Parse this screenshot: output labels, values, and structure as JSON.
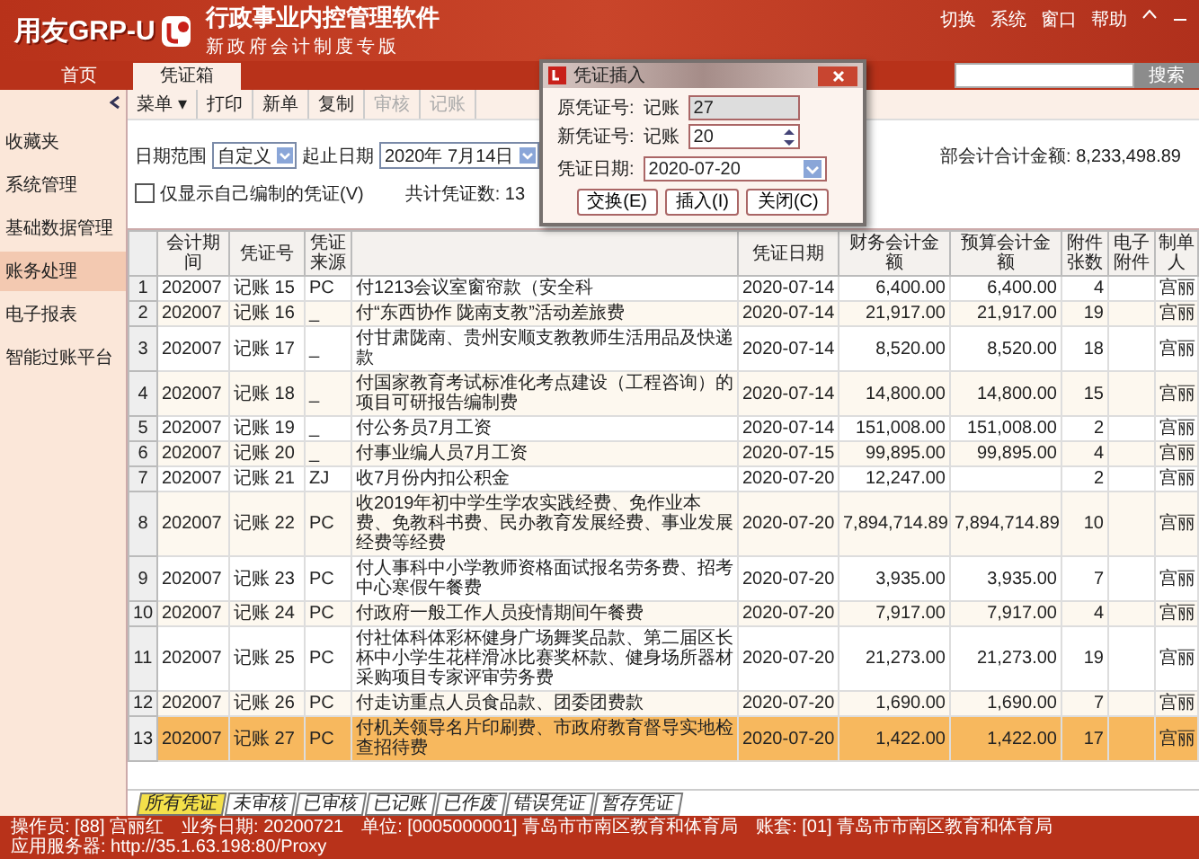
{
  "app": {
    "logo": "用友GRP-U",
    "product": "行政事业内控管理软件",
    "edition": "新政府会计制度专版",
    "menu": [
      "切换",
      "系统",
      "窗口",
      "帮助"
    ]
  },
  "tabs": [
    {
      "label": "首页",
      "selected": false
    },
    {
      "label": "凭证箱",
      "selected": true
    }
  ],
  "search": {
    "button": "搜索"
  },
  "sidebar": {
    "items": [
      {
        "label": "收藏夹",
        "selected": false
      },
      {
        "label": "系统管理",
        "selected": false
      },
      {
        "label": "基础数据管理",
        "selected": false
      },
      {
        "label": "账务处理",
        "selected": true
      },
      {
        "label": "电子报表",
        "selected": false
      },
      {
        "label": "智能过账平台",
        "selected": false
      }
    ]
  },
  "toolbar": [
    {
      "label": "菜单 ▾",
      "disabled": false
    },
    {
      "label": "打印",
      "disabled": false
    },
    {
      "label": "新单",
      "disabled": false
    },
    {
      "label": "复制",
      "disabled": false
    },
    {
      "label": "审核",
      "disabled": true
    },
    {
      "label": "记账",
      "disabled": true
    }
  ],
  "filters": {
    "range_label": "日期范围",
    "range_value": "自定义",
    "date_label": "起止日期",
    "date_value": "2020年 7月14日",
    "own_only": {
      "label": "仅显示自己编制的凭证(V)",
      "checked": false
    },
    "count": "共计凭证数: 13",
    "total": "部会计合计金额: 8,233,498.89"
  },
  "table": {
    "columns": [
      "会计期间",
      "凭证号",
      "凭证来源",
      "凭证日期",
      "财务会计金额",
      "预算会计金额",
      "附件张数",
      "电子附件",
      "制单人"
    ],
    "rows": [
      {
        "index": "1",
        "period": "202007",
        "number": "记账 15",
        "source": "PC",
        "summary": "付1213会议室窗帘款（安全科",
        "date": "2020-07-14",
        "financial": "6,400.00",
        "budget": "6,400.00",
        "attachments": "4",
        "maker": "宫丽",
        "selected": false
      },
      {
        "index": "2",
        "period": "202007",
        "number": "记账 16",
        "source": "_",
        "summary": "付“东西协作  陇南支教”活动差旅费",
        "date": "2020-07-14",
        "financial": "21,917.00",
        "budget": "21,917.00",
        "attachments": "19",
        "maker": "宫丽",
        "selected": false
      },
      {
        "index": "3",
        "period": "202007",
        "number": "记账 17",
        "source": "_",
        "summary": "付甘肃陇南、贵州安顺支教教师生活用品及快递款",
        "date": "2020-07-14",
        "financial": "8,520.00",
        "budget": "8,520.00",
        "attachments": "18",
        "maker": "宫丽",
        "selected": false
      },
      {
        "index": "4",
        "period": "202007",
        "number": "记账 18",
        "source": "_",
        "summary": "付国家教育考试标准化考点建设（工程咨询）的项目可研报告编制费",
        "date": "2020-07-14",
        "financial": "14,800.00",
        "budget": "14,800.00",
        "attachments": "15",
        "maker": "宫丽",
        "selected": false
      },
      {
        "index": "5",
        "period": "202007",
        "number": "记账 19",
        "source": "_",
        "summary": "付公务员7月工资",
        "date": "2020-07-14",
        "financial": "151,008.00",
        "budget": "151,008.00",
        "attachments": "2",
        "maker": "宫丽",
        "selected": false
      },
      {
        "index": "6",
        "period": "202007",
        "number": "记账 20",
        "source": "_",
        "summary": "付事业编人员7月工资",
        "date": "2020-07-15",
        "financial": "99,895.00",
        "budget": "99,895.00",
        "attachments": "4",
        "maker": "宫丽",
        "selected": false
      },
      {
        "index": "7",
        "period": "202007",
        "number": "记账 21",
        "source": "ZJ",
        "summary": "收7月份内扣公积金",
        "date": "2020-07-20",
        "financial": "12,247.00",
        "attachments": "2",
        "maker": "宫丽",
        "selected": false
      },
      {
        "index": "8",
        "period": "202007",
        "number": "记账 22",
        "source": "PC",
        "summary": "收2019年初中学生学农实践经费、免作业本费、免教科书费、民办教育发展经费、事业发展经费等经费",
        "date": "2020-07-20",
        "financial": "7,894,714.89",
        "budget": "7,894,714.89",
        "attachments": "10",
        "maker": "宫丽",
        "selected": false
      },
      {
        "index": "9",
        "period": "202007",
        "number": "记账 23",
        "source": "PC",
        "summary": "付人事科中小学教师资格面试报名劳务费、招考中心寒假午餐费",
        "date": "2020-07-20",
        "financial": "3,935.00",
        "budget": "3,935.00",
        "attachments": "7",
        "maker": "宫丽",
        "selected": false
      },
      {
        "index": "10",
        "period": "202007",
        "number": "记账 24",
        "source": "PC",
        "summary": "付政府一般工作人员疫情期间午餐费",
        "date": "2020-07-20",
        "financial": "7,917.00",
        "budget": "7,917.00",
        "attachments": "4",
        "maker": "宫丽",
        "selected": false
      },
      {
        "index": "11",
        "period": "202007",
        "number": "记账 25",
        "source": "PC",
        "summary": "付社体科体彩杯健身广场舞奖品款、第二届区长杯中小学生花样滑冰比赛奖杯款、健身场所器材采购项目专家评审劳务费",
        "date": "2020-07-20",
        "financial": "21,273.00",
        "budget": "21,273.00",
        "attachments": "19",
        "maker": "宫丽",
        "selected": false
      },
      {
        "index": "12",
        "period": "202007",
        "number": "记账 26",
        "source": "PC",
        "summary": "付走访重点人员食品款、团委团费款",
        "date": "2020-07-20",
        "financial": "1,690.00",
        "budget": "1,690.00",
        "attachments": "7",
        "maker": "宫丽",
        "selected": false
      },
      {
        "index": "13",
        "period": "202007",
        "number": "记账 27",
        "source": "PC",
        "summary": "付机关领导名片印刷费、市政府教育督导实地检查招待费",
        "date": "2020-07-20",
        "financial": "1,422.00",
        "budget": "1,422.00",
        "attachments": "17",
        "maker": "宫丽",
        "selected": true
      }
    ]
  },
  "bottom_tabs": [
    {
      "label": "所有凭证",
      "selected": true
    },
    {
      "label": "未审核",
      "selected": false
    },
    {
      "label": "已审核",
      "selected": false
    },
    {
      "label": "已记账",
      "selected": false
    },
    {
      "label": "已作废",
      "selected": false
    },
    {
      "label": "错误凭证",
      "selected": false
    },
    {
      "label": "暂存凭证",
      "selected": false
    }
  ],
  "status_bar": [
    "操作员: [88] 宫丽红",
    "业务日期: 20200721",
    "单位: [0005000001] 青岛市市南区教育和体育局",
    "账套: [01] 青岛市市南区教育和体育局",
    "应用服务器: http://35.1.63.198:80/Proxy"
  ],
  "dialog": {
    "title": "凭证插入",
    "fields": [
      {
        "label": "原凭证号:",
        "prefix": "记账",
        "value": "27",
        "kind": "text",
        "disabled": true
      },
      {
        "label": "新凭证号:",
        "prefix": "记账",
        "value": "20",
        "kind": "spin",
        "disabled": false
      },
      {
        "label": "凭证日期:",
        "value": "2020-07-20",
        "kind": "date",
        "disabled": false
      }
    ],
    "buttons": [
      "交换(E)",
      "插入(I)",
      "关闭(C)"
    ]
  }
}
